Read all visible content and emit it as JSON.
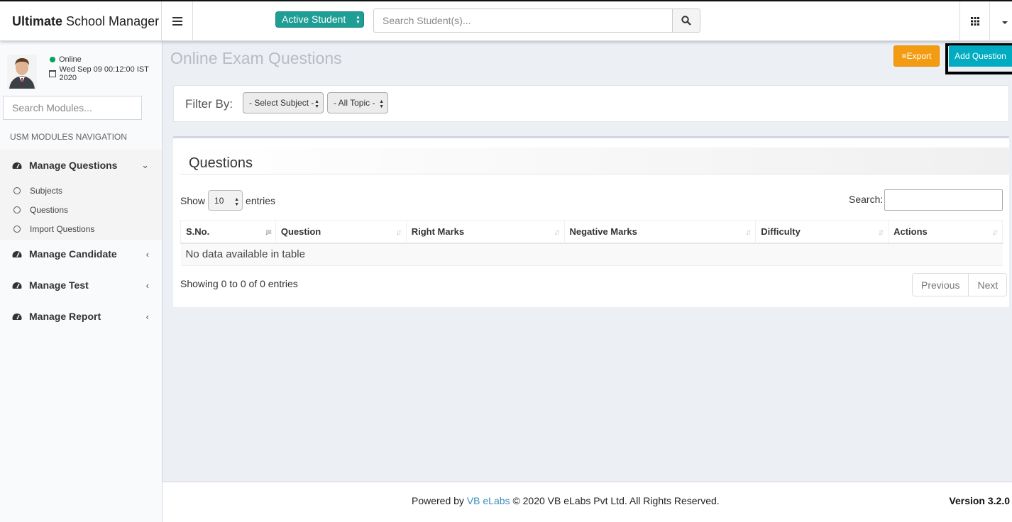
{
  "header": {
    "logo_bold": "Ultimate",
    "logo_rest": "School Manager",
    "student_filter": "Active Student",
    "search_placeholder": "Search Student(s)..."
  },
  "sidebar": {
    "status": "Online",
    "datetime": "Wed Sep 09 00:12:00 IST 2020",
    "search_placeholder": "Search Modules...",
    "nav_header": "USM MODULES NAVIGATION",
    "menus": [
      {
        "label": "Manage Questions",
        "expanded": true,
        "items": [
          {
            "label": "Subjects"
          },
          {
            "label": "Questions"
          },
          {
            "label": "Import Questions"
          }
        ]
      },
      {
        "label": "Manage Candidate",
        "expanded": false
      },
      {
        "label": "Manage Test",
        "expanded": false
      },
      {
        "label": "Manage Report",
        "expanded": false
      }
    ]
  },
  "page": {
    "title": "Online Exam Questions",
    "export_label": "Export",
    "add_label": "Add Question"
  },
  "filter": {
    "label": "Filter By:",
    "subject": "- Select Subject -",
    "topic": "- All Topic -"
  },
  "questions": {
    "title": "Questions",
    "show_label": "Show",
    "entries_label": "entries",
    "page_length": "10",
    "search_label": "Search:",
    "columns": [
      "S.No.",
      "Question",
      "Right Marks",
      "Negative Marks",
      "Difficulty",
      "Actions"
    ],
    "empty_text": "No data available in table",
    "info": "Showing 0 to 0 of 0 entries",
    "prev_label": "Previous",
    "next_label": "Next"
  },
  "footer": {
    "powered_by": "Powered by",
    "company_link": "VB eLabs",
    "copyright": "© 2020 VB eLabs Pvt Ltd. All Rights Reserved.",
    "version": "Version 3.2.0"
  },
  "colors": {
    "accent_teal": "#00acc1",
    "export_orange": "#f39c12",
    "active_student_green": "#1e9e94",
    "online_green": "#00a65a"
  }
}
